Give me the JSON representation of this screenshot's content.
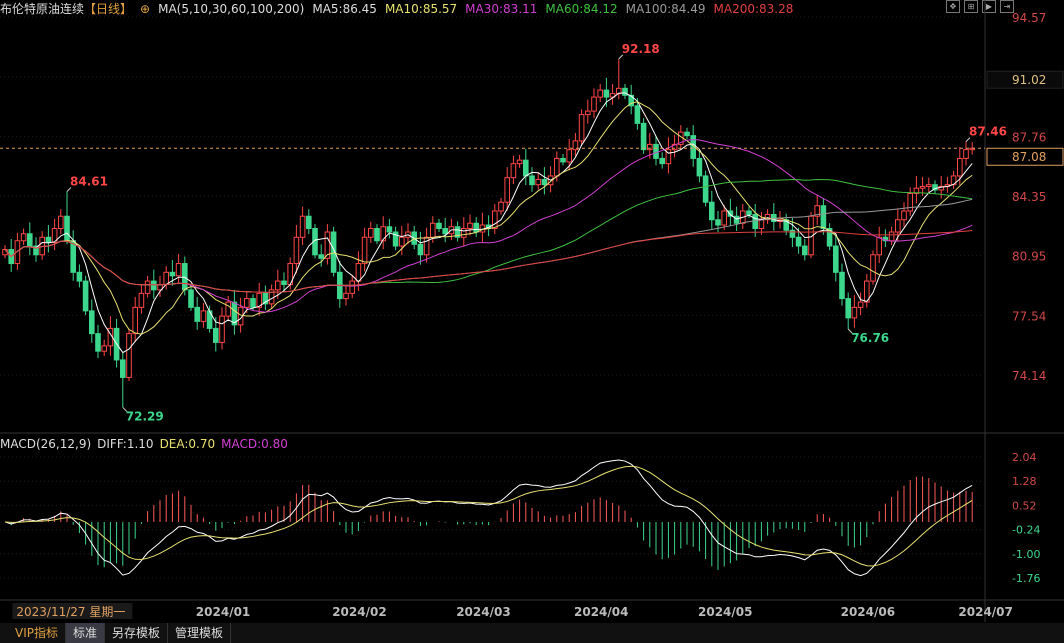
{
  "header": {
    "title": "布伦特原油连续",
    "period": "【日线】",
    "ma_params": "MA(5,10,30,60,100,200)",
    "ma5": "MA5:86.45",
    "ma10": "MA10:85.57",
    "ma30": "MA30:83.11",
    "ma60": "MA60:84.12",
    "ma100": "MA100:84.49",
    "ma200": "MA200:83.28"
  },
  "macd_header": {
    "params": "MACD(26,12,9)",
    "diff": "DIFF:1.10",
    "dea": "DEA:0.70",
    "macd": "MACD:0.80"
  },
  "tabs": [
    "VIP指标",
    "标准",
    "另存模板",
    "管理模板"
  ],
  "toolbar_icons": [
    "move-icon",
    "zoom-in-icon",
    "play-icon",
    "exit-icon"
  ],
  "colors": {
    "up": "#ff4646",
    "down": "#3cd68c",
    "ma5": "#ffffff",
    "ma10": "#e8e070",
    "ma30": "#d040d0",
    "ma60": "#40c040",
    "ma100": "#9a9a9a",
    "ma200": "#e04040"
  },
  "chart_data": {
    "type": "candlestick",
    "price_axis": {
      "ticks": [
        "94.57",
        "91.16",
        "87.76",
        "84.35",
        "80.95",
        "77.54",
        "74.14"
      ],
      "ylim": [
        74.14,
        94.57
      ],
      "crosshair_value": "91.02",
      "last_price": "87.08"
    },
    "macd_axis": {
      "ticks": [
        "2.04",
        "1.28",
        "0.52",
        "-0.24",
        "-1.00",
        "-1.76"
      ],
      "ylim": [
        -1.76,
        2.04
      ]
    },
    "x_labels": [
      {
        "label": "2023/11/27 星期一",
        "index": 7
      },
      {
        "label": "2024/01",
        "index": 34
      },
      {
        "label": "2024/02",
        "index": 56
      },
      {
        "label": "2024/03",
        "index": 76
      },
      {
        "label": "2024/04",
        "index": 95
      },
      {
        "label": "2024/05",
        "index": 115
      },
      {
        "label": "2024/06",
        "index": 138
      },
      {
        "label": "2024/07",
        "index": 157
      }
    ],
    "annotations": [
      {
        "label": "84.61",
        "index": 10,
        "value": 84.61,
        "kind": "high"
      },
      {
        "label": "72.29",
        "index": 19,
        "value": 72.29,
        "kind": "low"
      },
      {
        "label": "92.18",
        "index": 99,
        "value": 92.18,
        "kind": "high"
      },
      {
        "label": "76.76",
        "index": 136,
        "value": 76.76,
        "kind": "low"
      },
      {
        "label": "87.46",
        "index": 155,
        "value": 87.46,
        "kind": "high"
      }
    ],
    "closes": [
      81.3,
      80.5,
      81.8,
      82.2,
      81.5,
      81.0,
      82.0,
      81.7,
      82.5,
      83.2,
      81.8,
      80.0,
      79.5,
      77.8,
      76.5,
      75.5,
      75.8,
      76.8,
      75.0,
      74.0,
      76.5,
      78.0,
      78.8,
      79.5,
      79.0,
      79.3,
      80.0,
      79.8,
      80.5,
      79.0,
      78.0,
      77.2,
      77.8,
      76.8,
      76.0,
      77.5,
      78.3,
      77.0,
      78.0,
      78.5,
      78.0,
      78.8,
      78.2,
      79.0,
      79.5,
      79.3,
      80.5,
      82.0,
      83.2,
      82.5,
      81.0,
      80.8,
      82.3,
      80.0,
      78.5,
      78.8,
      79.5,
      80.5,
      82.0,
      82.5,
      81.8,
      82.6,
      82.3,
      81.5,
      82.0,
      82.3,
      81.6,
      81.0,
      82.0,
      82.8,
      82.5,
      82.2,
      82.6,
      82.0,
      82.5,
      82.8,
      82.3,
      82.7,
      82.5,
      83.5,
      84.0,
      85.4,
      86.2,
      86.4,
      85.5,
      85.0,
      85.3,
      85.0,
      85.5,
      86.5,
      86.3,
      87.0,
      87.5,
      89.0,
      89.2,
      90.0,
      90.4,
      90.0,
      90.2,
      90.5,
      90.1,
      89.5,
      88.5,
      87.0,
      87.3,
      86.5,
      86.2,
      87.0,
      87.3,
      88.0,
      87.8,
      86.5,
      85.5,
      84.0,
      83.0,
      82.7,
      83.5,
      83.2,
      82.8,
      83.5,
      83.3,
      82.5,
      83.0,
      83.3,
      82.9,
      83.0,
      82.4,
      82.0,
      81.5,
      81.0,
      83.2,
      83.8,
      82.5,
      81.5,
      80.0,
      78.5,
      77.4,
      78.0,
      78.3,
      79.5,
      81.0,
      82.0,
      81.8,
      82.3,
      83.0,
      83.5,
      84.5,
      84.8,
      84.9,
      85.0,
      84.7,
      84.9,
      85.0,
      85.5,
      86.5,
      87.0,
      87.08
    ]
  }
}
